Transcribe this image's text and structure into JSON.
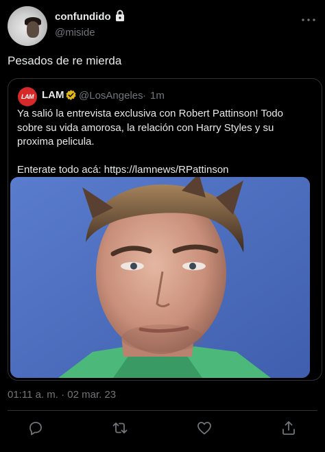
{
  "author": {
    "display_name": "confundido",
    "handle": "@miside",
    "avatar_icon": "profile-photo",
    "protected_icon": "lock-icon"
  },
  "tweet": {
    "text": "Pesados de re mierda",
    "timestamp": "01:11 a. m. · 02 mar. 23"
  },
  "quote": {
    "avatar_text": "LAM",
    "display_name": "LAM",
    "verified_icon": "verified-badge-icon",
    "handle": "@LosAngeles",
    "separator": "·",
    "time": "1m",
    "text_lines": [
      "Ya salió la entrevista exclusiva con Robert Pattinson! Todo",
      "sobre su vida amorosa, la relación con Harry Styles y su",
      "proxima pelicula."
    ],
    "link_line": "Enterate todo acá: https://lamnews/RPattinson",
    "media": "portrait-photo"
  },
  "actions": [
    {
      "name": "reply",
      "icon": "reply-icon"
    },
    {
      "name": "retweet",
      "icon": "retweet-icon"
    },
    {
      "name": "like",
      "icon": "heart-icon"
    },
    {
      "name": "share",
      "icon": "share-icon"
    }
  ],
  "colors": {
    "background": "#000000",
    "text_primary": "#e7e9ea",
    "text_secondary": "#71767b",
    "border": "#2f3336",
    "verified_gold": "#e2b719",
    "lam_red": "#d62a2a"
  }
}
